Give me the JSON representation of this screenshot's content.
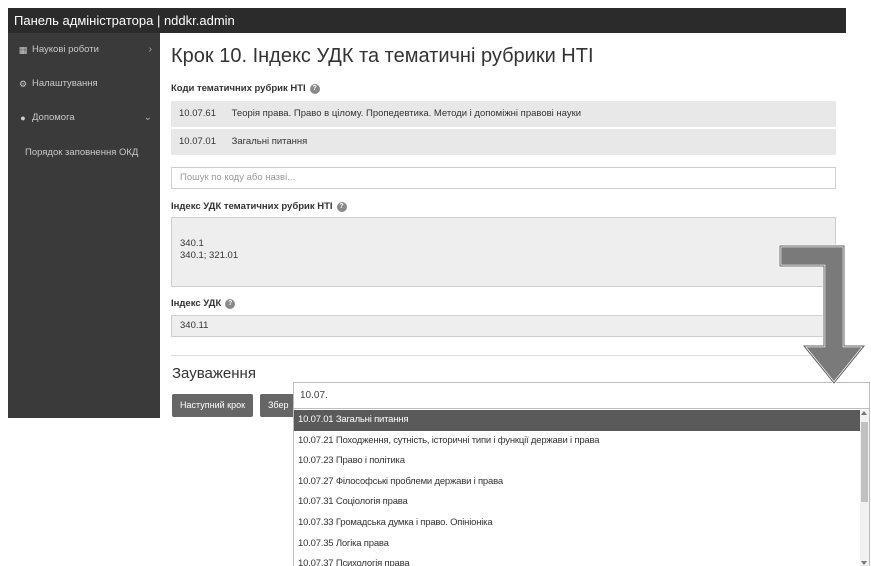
{
  "header": {
    "title": "Панель адміністратора | nddkr.admin"
  },
  "sidebar": {
    "items": [
      {
        "icon": "table-icon",
        "label": "Наукові роботи",
        "chevron": "›"
      },
      {
        "icon": "gears-icon",
        "label": "Налаштування"
      },
      {
        "icon": "question-circle-icon",
        "label": "Допомога",
        "chevron": "⌄"
      }
    ],
    "subitems": [
      {
        "label": "Порядок заповнення ОКД"
      }
    ]
  },
  "main": {
    "title": "Крок 10. Індекс УДК та тематичні рубрики НТІ",
    "rubric_codes_label": "Коди тематичних рубрик НТІ",
    "rubrics": [
      {
        "code": "10.07.61",
        "name": "Теорія права. Право в цілому. Пропедевтика. Методи і допоміжні правові науки"
      },
      {
        "code": "10.07.01",
        "name": "Загальні питання"
      }
    ],
    "search_placeholder": "Пошук по коду або назві...",
    "udc_rubrics_label": "Індекс УДК тематичних рубрик НТІ",
    "udc_rubrics_value": "340.1\n340.1; 321.01",
    "udc_label": "Індекс УДК",
    "udc_value": "340.11",
    "remarks_title": "Зауваження",
    "buttons": {
      "next": "Наступний крок",
      "save": "Збер"
    }
  },
  "dropdown": {
    "query": "10.07.",
    "items": [
      "10.07.01 Загальні питання",
      "10.07.21 Походження, сутність, історичні типи і функції держави і права",
      "10.07.23 Право і політика",
      "10.07.27 Філософські проблеми держави і права",
      "10.07.31 Соціологія права",
      "10.07.33 Громадська думка і право. Опініоніка",
      "10.07.35 Логіка права",
      "10.07.37 Психологія права"
    ],
    "selected_index": 0
  },
  "colors": {
    "topbar": "#2b2b2b",
    "sidebar": "#3a3a3a",
    "selected_item": "#5a5a5a",
    "annotation_arrow": "#7a7a7a"
  }
}
